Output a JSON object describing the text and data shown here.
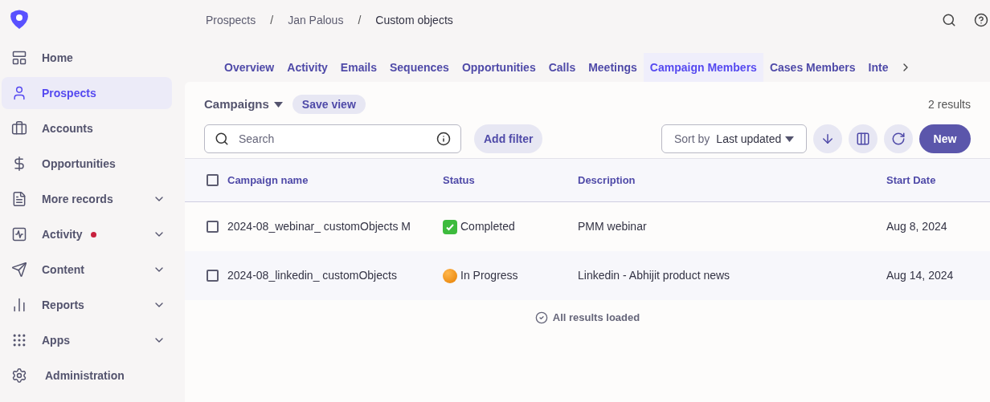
{
  "sidebar": {
    "items": [
      {
        "label": "Home",
        "selected": false,
        "expandable": false,
        "notification": false
      },
      {
        "label": "Prospects",
        "selected": true,
        "expandable": false,
        "notification": false
      },
      {
        "label": "Accounts",
        "selected": false,
        "expandable": false,
        "notification": false
      },
      {
        "label": "Opportunities",
        "selected": false,
        "expandable": false,
        "notification": false
      },
      {
        "label": "More records",
        "selected": false,
        "expandable": true,
        "notification": false
      },
      {
        "label": "Activity",
        "selected": false,
        "expandable": true,
        "notification": true
      },
      {
        "label": "Content",
        "selected": false,
        "expandable": true,
        "notification": false
      },
      {
        "label": "Reports",
        "selected": false,
        "expandable": true,
        "notification": false
      },
      {
        "label": "Apps",
        "selected": false,
        "expandable": true,
        "notification": false
      },
      {
        "label": "Administration",
        "selected": false,
        "expandable": false,
        "notification": false
      }
    ]
  },
  "breadcrumbs": [
    "Prospects",
    "Jan Palous",
    "Custom objects"
  ],
  "breadcrumb_separator": "/",
  "tabs": [
    {
      "label": "Overview",
      "selected": false
    },
    {
      "label": "Activity",
      "selected": false
    },
    {
      "label": "Emails",
      "selected": false
    },
    {
      "label": "Sequences",
      "selected": false
    },
    {
      "label": "Opportunities",
      "selected": false
    },
    {
      "label": "Calls",
      "selected": false
    },
    {
      "label": "Meetings",
      "selected": false
    },
    {
      "label": "Campaign Members",
      "selected": true
    },
    {
      "label": "Cases Members",
      "selected": false
    },
    {
      "label": "Inte",
      "selected": false
    }
  ],
  "toolbar": {
    "view": "Campaigns",
    "save_view": "Save view",
    "results": "2 results",
    "search": {
      "placeholder": "Search"
    },
    "add_filter": "Add filter",
    "sort_label": "Sort by",
    "sort_value": "Last updated",
    "new_button": "New"
  },
  "table": {
    "all_checked": false,
    "columns": [
      "Campaign name",
      "Status",
      "Description",
      "Start Date"
    ],
    "rows": [
      {
        "checked": false,
        "name": "2024-08_webinar_ customObjects M",
        "status": {
          "kind": "completed",
          "text": "Completed"
        },
        "description": "PMM webinar",
        "start_date": "Aug 8, 2024"
      },
      {
        "checked": false,
        "name": "2024-08_linkedin_ customObjects",
        "status": {
          "kind": "in_progress",
          "text": "In Progress"
        },
        "description": "Linkedin - Abhijit product news",
        "start_date": "Aug 14, 2024"
      }
    ]
  },
  "footer": "All results loaded"
}
